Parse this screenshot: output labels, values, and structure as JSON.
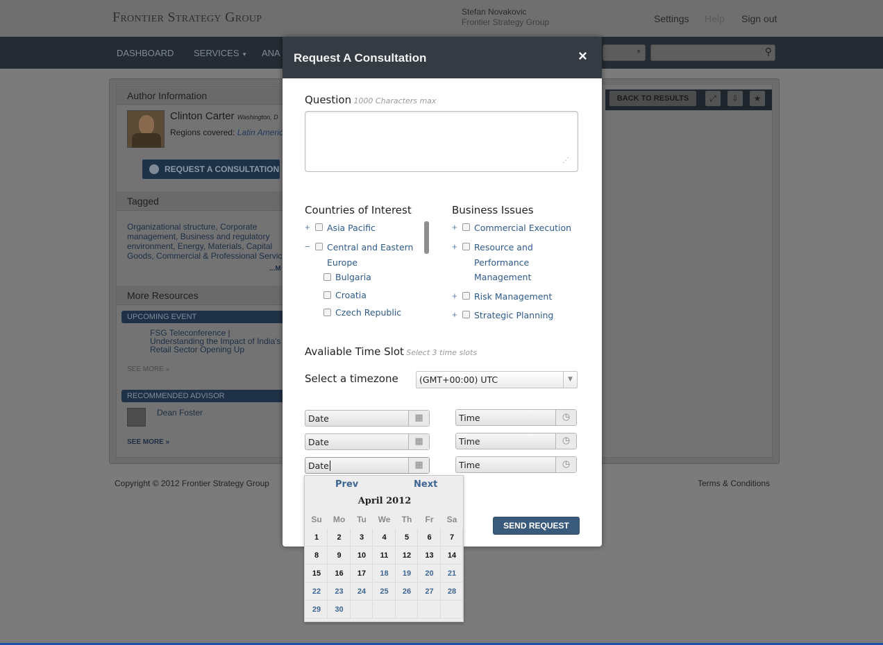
{
  "app": {
    "brand": "Frontier Strategy Group",
    "user_name": "Stefan Novakovic",
    "user_org": "Frontier Strategy Group",
    "links": {
      "settings": "Settings",
      "help": "Help",
      "sign_out": "Sign out"
    }
  },
  "nav": {
    "items": [
      "DASHBOARD",
      "SERVICES",
      "ANA"
    ]
  },
  "sidebar": {
    "author_heading": "Author Information",
    "author_name": "Clinton Carter",
    "author_location": "Washington, D",
    "regions_label": "Regions covered:",
    "regions_value": "Latin America",
    "consult_button": "REQUEST A CONSULTATION",
    "tagged_heading": "Tagged",
    "tags": "Organizational structure, Corporate management, Business and regulatory environment, Energy, Materials, Capital Goods, Commercial & Professional Servic",
    "tags_more": "...M",
    "more_resources_heading": "More Resources",
    "upcoming_event_label": "UPCOMING EVENT",
    "event_title": "FSG Teleconference | Understanding the Impact of India's Retail Sector Opening Up",
    "see_more_1": "SEE MORE »",
    "recommended_advisor_label": "RECOMMENDED ADVISOR",
    "advisor_name": "Dean Foster",
    "see_more_2": "SEE MORE »"
  },
  "toolbar": {
    "back_to_results": "BACK TO RESULTS"
  },
  "footer": {
    "copyright": "Copyright © 2012 Frontier Strategy Group",
    "terms": "Terms & Conditions"
  },
  "modal": {
    "title": "Request A Consultation",
    "close": "×",
    "question_label": "Question",
    "question_hint": "1000 Characters max",
    "question_value": "",
    "countries_label": "Countries of Interest",
    "countries": {
      "asia_pacific": "Asia Pacific",
      "cee_line1": "Central and Eastern",
      "cee_line2": "Europe",
      "bulgaria": "Bulgaria",
      "croatia": "Croatia",
      "czech": "Czech Republic"
    },
    "issues_label": "Business Issues",
    "issues": {
      "commercial": "Commercial Execution",
      "resource_l1": "Resource and",
      "resource_l2": "Performance",
      "resource_l3": "Management",
      "risk": "Risk Management",
      "strategic": "Strategic Planning"
    },
    "timeslot_label": "Avaliable Time Slot",
    "timeslot_hint": "Select 3 time slots",
    "timezone_label": "Select a timezone",
    "timezone_value": "(GMT+00:00) UTC",
    "date_placeholder": "Date",
    "time_placeholder": "Time",
    "send_button": "SEND REQUEST"
  },
  "calendar": {
    "prev": "Prev",
    "next": "Next",
    "month": "April 2012",
    "weekdays": [
      "Su",
      "Mo",
      "Tu",
      "We",
      "Th",
      "Fr",
      "Sa"
    ],
    "weeks": [
      [
        "1",
        "2",
        "3",
        "4",
        "5",
        "6",
        "7"
      ],
      [
        "8",
        "9",
        "10",
        "11",
        "12",
        "13",
        "14"
      ],
      [
        "15",
        "16",
        "17",
        "18",
        "19",
        "20",
        "21"
      ],
      [
        "22",
        "23",
        "24",
        "25",
        "26",
        "27",
        "28"
      ],
      [
        "29",
        "30",
        "",
        "",
        "",
        "",
        ""
      ]
    ],
    "last_past_day": 17
  },
  "colors": {
    "overlay": "#7b7b7b",
    "modal_header": "#353b42",
    "link_blue": "#2e5a8a",
    "send_button": "#3a5a7c"
  }
}
